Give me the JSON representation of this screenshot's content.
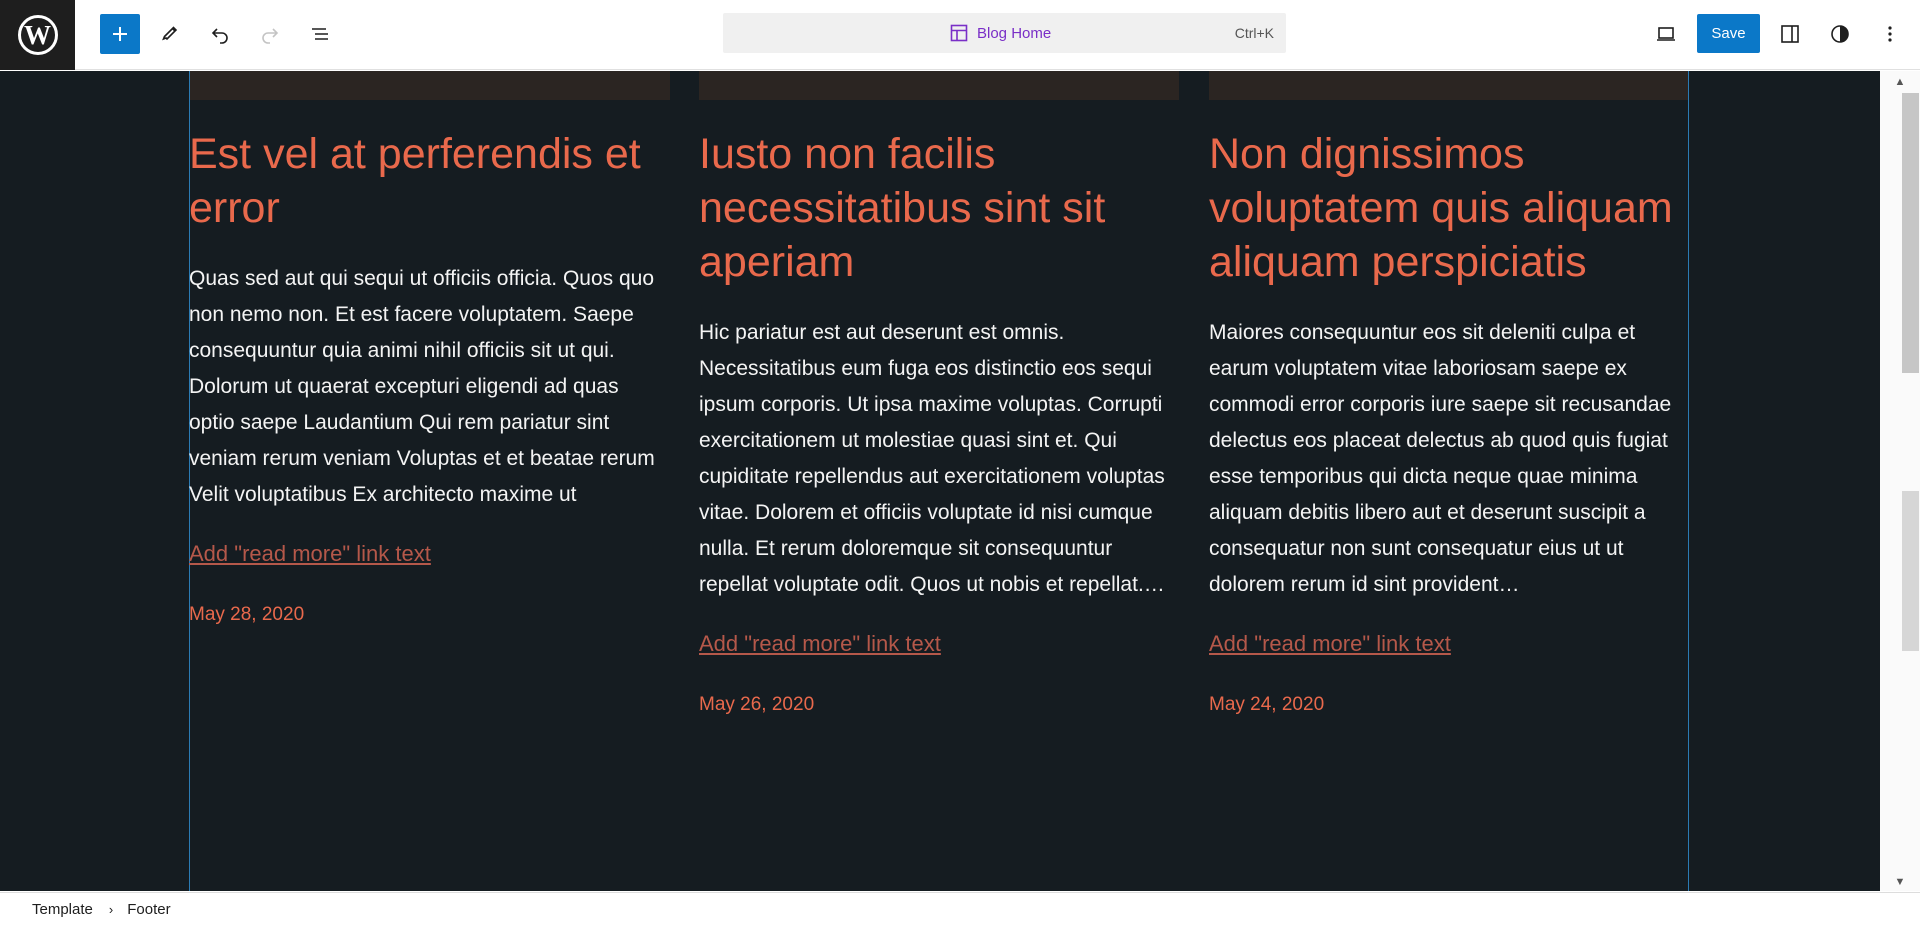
{
  "toolbar": {
    "wp_logo": "W",
    "command_bar": {
      "title": "Blog Home",
      "shortcut": "Ctrl+K"
    },
    "save_label": "Save"
  },
  "posts": [
    {
      "title": "Est vel at perferendis et error",
      "excerpt": "Quas sed aut qui sequi ut officiis officia. Quos quo non nemo non. Et est facere voluptatem. Saepe consequuntur quia animi nihil officiis sit ut qui. Dolorum ut quaerat excepturi eligendi ad quas optio saepe Laudantium Qui rem pariatur sint veniam rerum veniam Voluptas et et beatae rerum Velit voluptatibus Ex architecto maxime ut",
      "read_more": "Add \"read more\" link text",
      "date": "May 28, 2020"
    },
    {
      "title": "Iusto non facilis necessitatibus sint sit aperiam",
      "excerpt": "Hic pariatur est aut deserunt est omnis. Necessitatibus eum fuga eos distinctio eos sequi ipsum corporis. Ut ipsa maxime voluptas. Corrupti exercitationem ut molestiae quasi sint et. Qui cupiditate repellendus aut exercitationem voluptas vitae. Dolorem et officiis voluptate id nisi cumque nulla. Et rerum doloremque sit consequuntur repellat voluptate odit. Quos ut nobis et repellat.…",
      "read_more": "Add \"read more\" link text",
      "date": "May 26, 2020"
    },
    {
      "title": "Non dignissimos voluptatem quis aliquam aliquam perspiciatis",
      "excerpt": "Maiores consequuntur eos sit deleniti culpa et earum voluptatem vitae laboriosam saepe ex commodi error corporis iure saepe sit recusandae delectus eos placeat delectus ab quod quis fugiat esse temporibus qui dicta neque quae minima aliquam debitis libero aut et deserunt suscipit a consequatur non sunt consequatur eius ut ut dolorem rerum id sint provident…",
      "read_more": "Add \"read more\" link text",
      "date": "May 24, 2020"
    }
  ],
  "breadcrumb": [
    "Template",
    "Footer"
  ],
  "colors": {
    "accent": "#0b78c8",
    "canvas_bg": "#151c21",
    "heading": "#e9694c",
    "link": "#b5584a",
    "document_title": "#7a2fc7"
  }
}
